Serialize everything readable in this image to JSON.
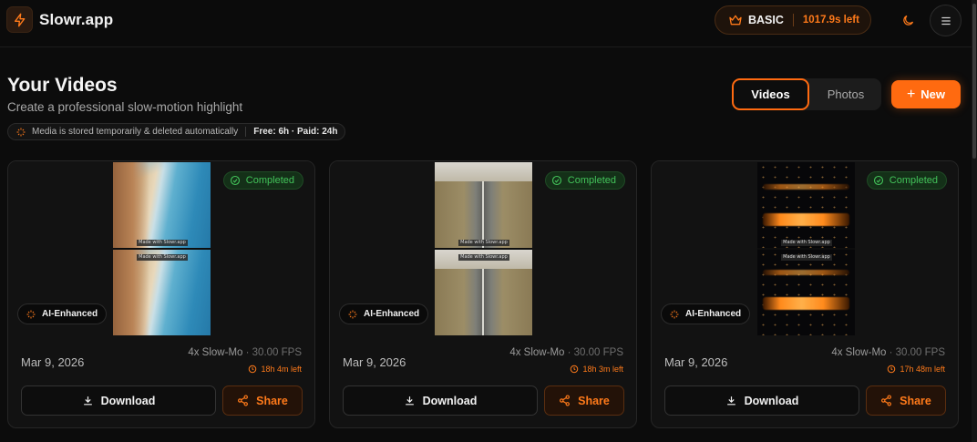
{
  "app": {
    "name": "Slowr.app"
  },
  "plan": {
    "name": "BASIC",
    "time_left": "1017.9s left"
  },
  "header": {
    "title": "Your Videos",
    "subtitle": "Create a professional slow-motion highlight",
    "notice": "Media is stored temporarily & deleted automatically",
    "retention": "Free: 6h · Paid: 24h"
  },
  "tabs": {
    "videos": "Videos",
    "photos": "Photos",
    "active": "Videos"
  },
  "new_button": {
    "label": "New"
  },
  "watermark_text": "Made with Slowr.app",
  "cards": [
    {
      "status": "Completed",
      "badge": "AI-Enhanced",
      "date": "Mar 9, 2026",
      "speed": "4x Slow-Mo",
      "fps": "30.00 FPS",
      "expires": "18h 4m left",
      "download": "Download",
      "share": "Share",
      "thumbnail": "beach-coastline"
    },
    {
      "status": "Completed",
      "badge": "AI-Enhanced",
      "date": "Mar 9, 2026",
      "speed": "4x Slow-Mo",
      "fps": "30.00 FPS",
      "expires": "18h 3m left",
      "download": "Download",
      "share": "Share",
      "thumbnail": "highway-aerial"
    },
    {
      "status": "Completed",
      "badge": "AI-Enhanced",
      "date": "Mar 9, 2026",
      "speed": "4x Slow-Mo",
      "fps": "30.00 FPS",
      "expires": "17h 48m left",
      "download": "Download",
      "share": "Share",
      "thumbnail": "night-lights"
    }
  ],
  "colors": {
    "accent": "#ff6a10",
    "success": "#43c35a",
    "background": "#0c0c0c"
  }
}
